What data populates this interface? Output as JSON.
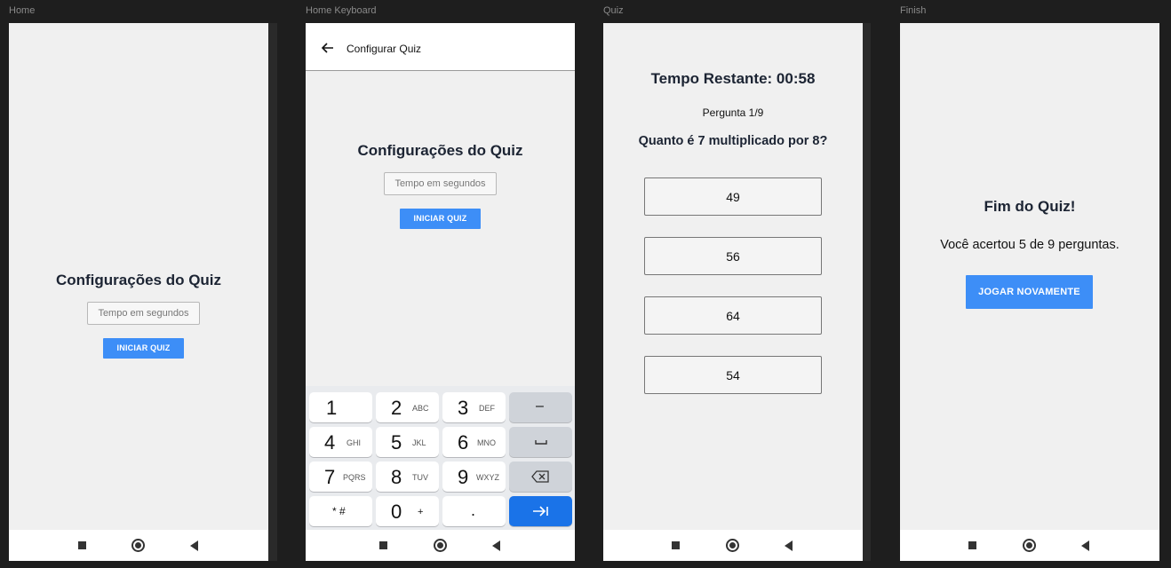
{
  "frames": {
    "home": "Home",
    "keyboard": "Home Keyboard",
    "quiz": "Quiz",
    "finish": "Finish"
  },
  "home": {
    "title": "Configurações do Quiz",
    "input_placeholder": "Tempo em segundos",
    "start_button": "INICIAR QUIZ"
  },
  "config": {
    "appbar_title": "Configurar Quiz",
    "title": "Configurações do Quiz",
    "input_placeholder": "Tempo em segundos",
    "start_button": "INICIAR QUIZ",
    "keys": [
      {
        "main": "1",
        "sub": ""
      },
      {
        "main": "2",
        "sub": "ABC"
      },
      {
        "main": "3",
        "sub": "DEF"
      },
      {
        "main": "–",
        "sub": ""
      },
      {
        "main": "4",
        "sub": "GHI"
      },
      {
        "main": "5",
        "sub": "JKL"
      },
      {
        "main": "6",
        "sub": "MNO"
      },
      {
        "main": "␣",
        "sub": ""
      },
      {
        "main": "7",
        "sub": "PQRS"
      },
      {
        "main": "8",
        "sub": "TUV"
      },
      {
        "main": "9",
        "sub": "WXYZ"
      },
      {
        "main": "⌫",
        "sub": ""
      },
      {
        "main": "* #",
        "sub": ""
      },
      {
        "main": "0",
        "sub": "+"
      },
      {
        "main": ".",
        "sub": ""
      },
      {
        "main": "→|",
        "sub": ""
      }
    ]
  },
  "quiz": {
    "timer": "Tempo Restante: 00:58",
    "progress": "Pergunta 1/9",
    "question": "Quanto é 7 multiplicado por 8?",
    "answers": [
      "49",
      "56",
      "64",
      "54"
    ]
  },
  "finish": {
    "title": "Fim do Quiz!",
    "result": "Você acertou 5 de 9 perguntas.",
    "restart_button": "JOGAR NOVAMENTE"
  },
  "colors": {
    "accent": "#3d8ef7",
    "keyboard_action": "#1a73e8",
    "screen_bg": "#f0f0f0",
    "canvas_bg": "#1e1e1e"
  }
}
